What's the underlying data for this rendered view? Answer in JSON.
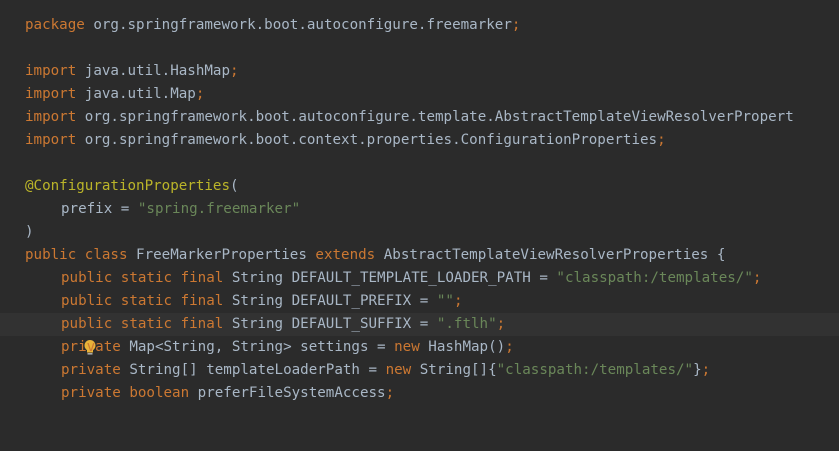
{
  "editor": {
    "l1": {
      "kw": "package",
      "rest": " org.springframework.boot.autoconfigure.freemarker",
      "semi": ";"
    },
    "l3": {
      "kw": "import",
      "rest": " java.util.HashMap",
      "semi": ";"
    },
    "l4": {
      "kw": "import",
      "rest": " java.util.Map",
      "semi": ";"
    },
    "l5": {
      "kw": "import",
      "rest": " org.springframework.boot.autoconfigure.template.AbstractTemplateViewResolverPropert"
    },
    "l6": {
      "kw": "import",
      "rest": " org.springframework.boot.context.properties.ConfigurationProperties",
      "semi": ";"
    },
    "l8": {
      "ann": "@ConfigurationProperties",
      "rest": "("
    },
    "l9": {
      "rest": "prefix = ",
      "str": "\"spring.freemarker\""
    },
    "l10": {
      "rest": ")"
    },
    "l11": {
      "kw1": "public class",
      "rest1": " FreeMarkerProperties ",
      "kw2": "extends",
      "rest2": " AbstractTemplateViewResolverProperties {"
    },
    "l12": {
      "kw": "public static final",
      "rest": " String DEFAULT_TEMPLATE_LOADER_PATH = ",
      "str": "\"classpath:/templates/\"",
      "semi": ";"
    },
    "l13": {
      "kw": "public static final",
      "rest": " String DEFAULT_PREFIX = ",
      "str": "\"\"",
      "semi": ";"
    },
    "l14": {
      "kw": "public static final",
      "rest": " String DEFAULT_SUFFIX = ",
      "str": "\".ftlh\"",
      "semi": ";"
    },
    "l15": {
      "kw": "private",
      "rest": " Map<String, String> settings = ",
      "kw2": "new",
      "rest2": " HashMap()",
      "semi": ";"
    },
    "l16": {
      "kw": "private",
      "rest": " String[] templateLoaderPath = ",
      "kw2": "new",
      "rest2": " String[]{",
      "str": "\"classpath:/templates/\"",
      "rest3": "}",
      "semi": ";"
    },
    "l17": {
      "kw": "private",
      "kw2": " boolean",
      "rest": " preferFileSystemAccess",
      "semi": ";"
    }
  },
  "colors": {
    "background": "#2b2b2b",
    "current_line": "#323232",
    "keyword": "#cc7832",
    "string": "#6a8759",
    "annotation": "#bbb529",
    "text": "#a9b7c6",
    "bulb": "#e8b339"
  },
  "icons": {
    "gutter": "lightbulb-icon"
  }
}
